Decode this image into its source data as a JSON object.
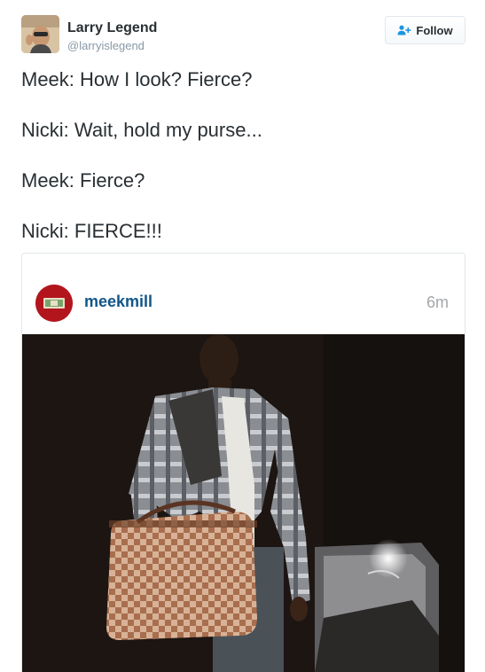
{
  "author": {
    "name": "Larry Legend",
    "handle": "@larryislegend"
  },
  "follow": {
    "label": "Follow",
    "icon": "add-user-icon",
    "color": "#1b95e0"
  },
  "tweet": {
    "lines": [
      "Meek: How I look? Fierce?",
      "Nicki: Wait, hold my purse...",
      "Meek: Fierce?",
      "Nicki: FIERCE!!!"
    ]
  },
  "embed": {
    "username": "meekmill",
    "time": "6m",
    "username_color": "#125688",
    "avatar_color": "#b3151d",
    "photo_description_icon": "photo-image"
  }
}
